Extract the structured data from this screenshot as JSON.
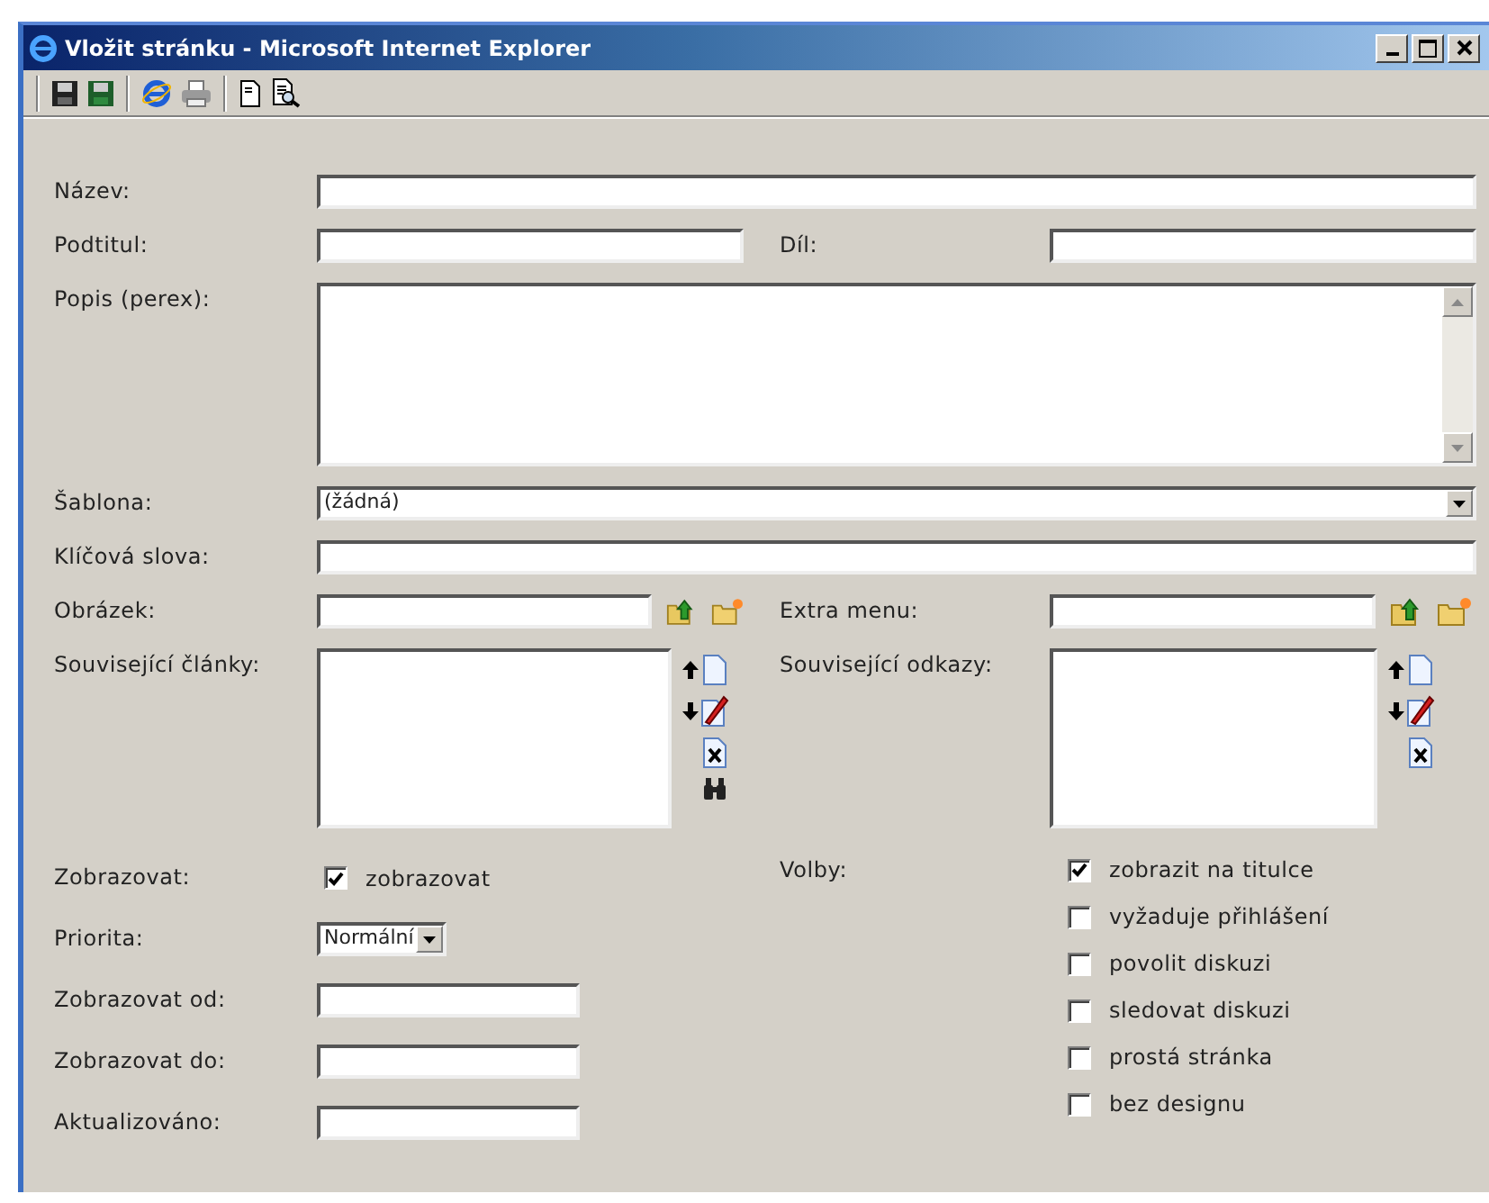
{
  "window": {
    "title": "Vložit stránku - Microsoft Internet Explorer"
  },
  "form": {
    "title": {
      "label": "Název:"
    },
    "subtitle": {
      "label": "Podtitul:"
    },
    "part": {
      "label": "Díl:"
    },
    "perex": {
      "label": "Popis (perex):"
    },
    "template": {
      "label": "Šablona:",
      "value": "(žádná)"
    },
    "keywords": {
      "label": "Klíčová slova:"
    },
    "image": {
      "label": "Obrázek:"
    },
    "extra_menu": {
      "label": "Extra menu:"
    },
    "related_articles": {
      "label": "Související články:"
    },
    "related_links": {
      "label": "Související odkazy:"
    },
    "show": {
      "label": "Zobrazovat:",
      "checkbox": {
        "label": "zobrazovat",
        "checked": true
      }
    },
    "priority": {
      "label": "Priorita:",
      "value": "Normální"
    },
    "show_from": {
      "label": "Zobrazovat od:"
    },
    "show_to": {
      "label": "Zobrazovat do:"
    },
    "updated": {
      "label": "Aktualizováno:"
    },
    "options": {
      "label": "Volby:",
      "items": [
        {
          "label": "zobrazit na titulce",
          "checked": true
        },
        {
          "label": "vyžaduje přihlášení",
          "checked": false
        },
        {
          "label": "povolit diskuzi",
          "checked": false
        },
        {
          "label": "sledovat diskuzi",
          "checked": false
        },
        {
          "label": "prostá stránka",
          "checked": false
        },
        {
          "label": "bez designu",
          "checked": false
        }
      ]
    }
  }
}
